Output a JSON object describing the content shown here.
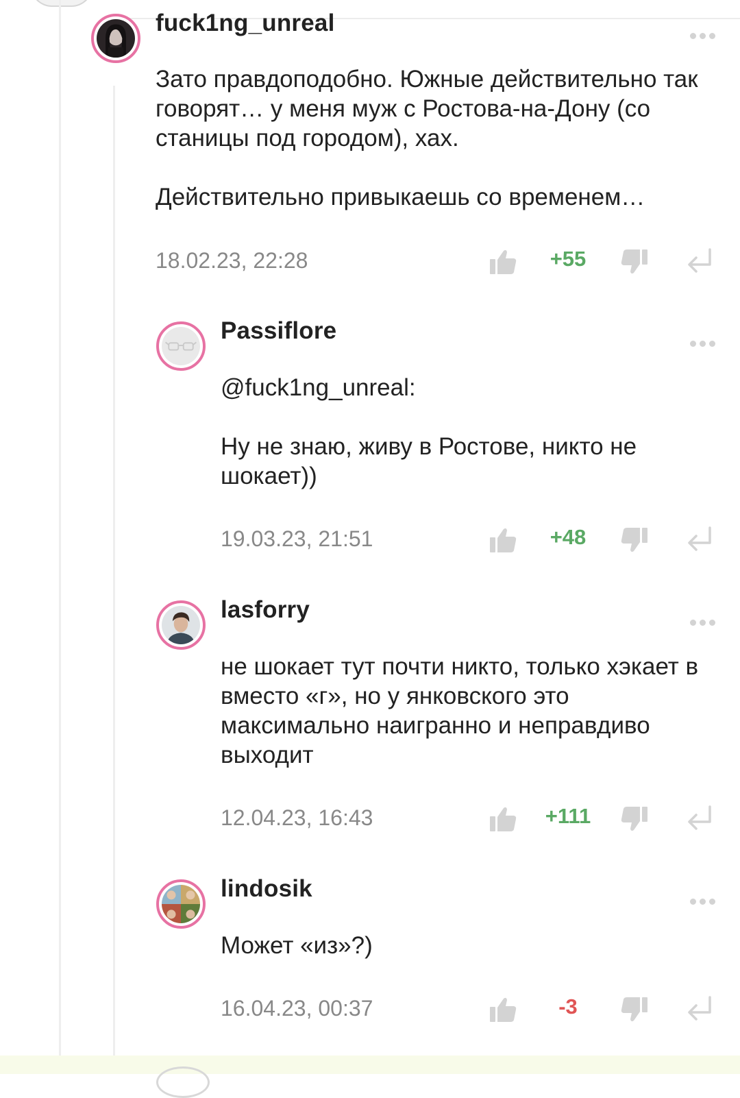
{
  "colors": {
    "accent_avatar_ring": "#e772a3",
    "positive_rating": "#5aa964",
    "negative_rating": "#e05555",
    "muted_text": "#888888",
    "icon_gray": "#d3d3d3"
  },
  "comments": [
    {
      "username": "fuck1ng_unreal",
      "avatar_icon": "dark-hair-portrait",
      "paragraphs": [
        "Зато правдоподобно. Южные действительно так говорят… у меня муж с Ростова-на-Дону (со станицы под городом), хах.",
        "Действительно привыкаешь со временем…"
      ],
      "date": "18.02.23, 22:28",
      "rating": "+55",
      "rating_sign": "positive"
    },
    {
      "username": "Passiflore",
      "avatar_icon": "glasses-placeholder",
      "paragraphs": [
        "@fuck1ng_unreal:",
        "Ну не знаю, живу в Ростове, никто не шокает))"
      ],
      "date": "19.03.23, 21:51",
      "rating": "+48",
      "rating_sign": "positive"
    },
    {
      "username": "lasforry",
      "avatar_icon": "person-photo",
      "paragraphs": [
        "не шокает тут почти никто, только хэкает в вместо «г», но у янковского это максимально наигранно и неправдиво выходит"
      ],
      "date": "12.04.23, 16:43",
      "rating": "+111",
      "rating_sign": "positive"
    },
    {
      "username": "lindosik",
      "avatar_icon": "collage-photo",
      "paragraphs": [
        "Может «из»?)"
      ],
      "date": "16.04.23, 00:37",
      "rating": "-3",
      "rating_sign": "negative"
    }
  ]
}
